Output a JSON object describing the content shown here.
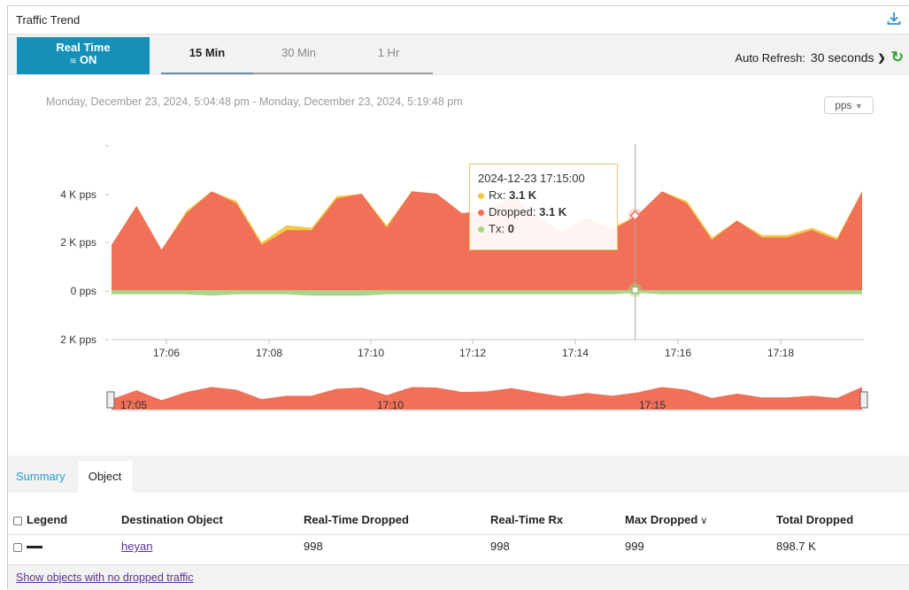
{
  "widget": {
    "title": "Traffic Trend",
    "download_icon": "download-icon"
  },
  "tabs": {
    "realtime_label": "Real Time",
    "realtime_state": "ON",
    "items": [
      "15 Min",
      "30 Min",
      "1 Hr"
    ],
    "active": "15 Min"
  },
  "auto_refresh": {
    "label": "Auto Refresh:",
    "value": "30 seconds",
    "refresh_icon": "refresh-icon"
  },
  "time_range": "Monday, December 23, 2024, 5:04:48 pm - Monday, December 23, 2024, 5:19:48 pm",
  "unit_select": "pps",
  "chart_data": {
    "type": "area",
    "y_tick_labels": [
      "4 K pps",
      "2 K pps",
      "0 pps",
      "2 K pps"
    ],
    "x_tick_labels": [
      "17:06",
      "17:08",
      "17:10",
      "17:12",
      "17:14",
      "17:16",
      "17:18"
    ],
    "navigator_labels": [
      "17:05",
      "17:10",
      "17:15"
    ],
    "x": [
      "17:04:48",
      "17:05:20",
      "17:05:50",
      "17:06:20",
      "17:06:50",
      "17:07:20",
      "17:07:50",
      "17:08:20",
      "17:08:50",
      "17:09:20",
      "17:09:50",
      "17:10:20",
      "17:10:50",
      "17:11:20",
      "17:11:50",
      "17:12:20",
      "17:12:50",
      "17:13:20",
      "17:13:50",
      "17:14:20",
      "17:14:50",
      "17:15:20",
      "17:15:50",
      "17:16:20",
      "17:16:50",
      "17:17:20",
      "17:17:50",
      "17:18:20",
      "17:18:50",
      "17:19:20",
      "17:19:48"
    ],
    "series": [
      {
        "name": "Rx",
        "color": "#f5c842",
        "values": [
          1.9,
          3.5,
          1.7,
          3.3,
          4.1,
          3.7,
          2.0,
          2.7,
          2.6,
          3.9,
          4.0,
          2.7,
          4.1,
          4.0,
          3.2,
          3.3,
          3.9,
          3.1,
          2.5,
          3.0,
          2.6,
          3.1,
          4.1,
          3.7,
          2.2,
          2.9,
          2.3,
          2.3,
          2.6,
          2.2,
          4.1
        ]
      },
      {
        "name": "Dropped",
        "color": "#f07058",
        "values": [
          1.9,
          3.5,
          1.7,
          3.2,
          4.1,
          3.6,
          1.9,
          2.5,
          2.5,
          3.8,
          4.0,
          2.6,
          4.1,
          4.0,
          3.2,
          3.3,
          3.9,
          3.1,
          2.4,
          3.0,
          2.5,
          3.1,
          4.1,
          3.6,
          2.1,
          2.9,
          2.2,
          2.2,
          2.5,
          2.1,
          4.1
        ]
      },
      {
        "name": "Tx",
        "color": "#a8d58a",
        "values": [
          -0.1,
          -0.1,
          -0.1,
          -0.1,
          -0.2,
          -0.1,
          -0.1,
          -0.1,
          -0.2,
          -0.2,
          -0.2,
          -0.1,
          -0.1,
          -0.1,
          -0.1,
          -0.1,
          -0.1,
          -0.1,
          -0.1,
          -0.1,
          -0.1,
          0,
          -0.1,
          -0.1,
          -0.1,
          -0.1,
          -0.1,
          -0.1,
          -0.1,
          -0.1,
          -0.1
        ]
      }
    ],
    "ylim": [
      -2,
      6
    ],
    "unit": "pps",
    "grid": false,
    "hover_index": 21
  },
  "tooltip": {
    "time": "2024-12-23 17:15:00",
    "rows": [
      {
        "name": "Rx",
        "value": "3.1 K",
        "color": "#f5c842"
      },
      {
        "name": "Dropped",
        "value": "3.1 K",
        "color": "#f07058"
      },
      {
        "name": "Tx",
        "value": "0",
        "color": "#a8d58a"
      }
    ]
  },
  "subtabs": {
    "summary": "Summary",
    "object": "Object"
  },
  "table": {
    "headers": {
      "legend": "Legend",
      "destination": "Destination Object",
      "rt_dropped": "Real-Time Dropped",
      "rt_rx": "Real-Time Rx",
      "max_dropped": "Max Dropped",
      "total_dropped": "Total Dropped"
    },
    "rows": [
      {
        "destination": "heyan",
        "rt_dropped": "998",
        "rt_rx": "998",
        "max_dropped": "999",
        "total_dropped": "898.7 K"
      }
    ]
  },
  "footer_link": "Show objects with no dropped traffic"
}
